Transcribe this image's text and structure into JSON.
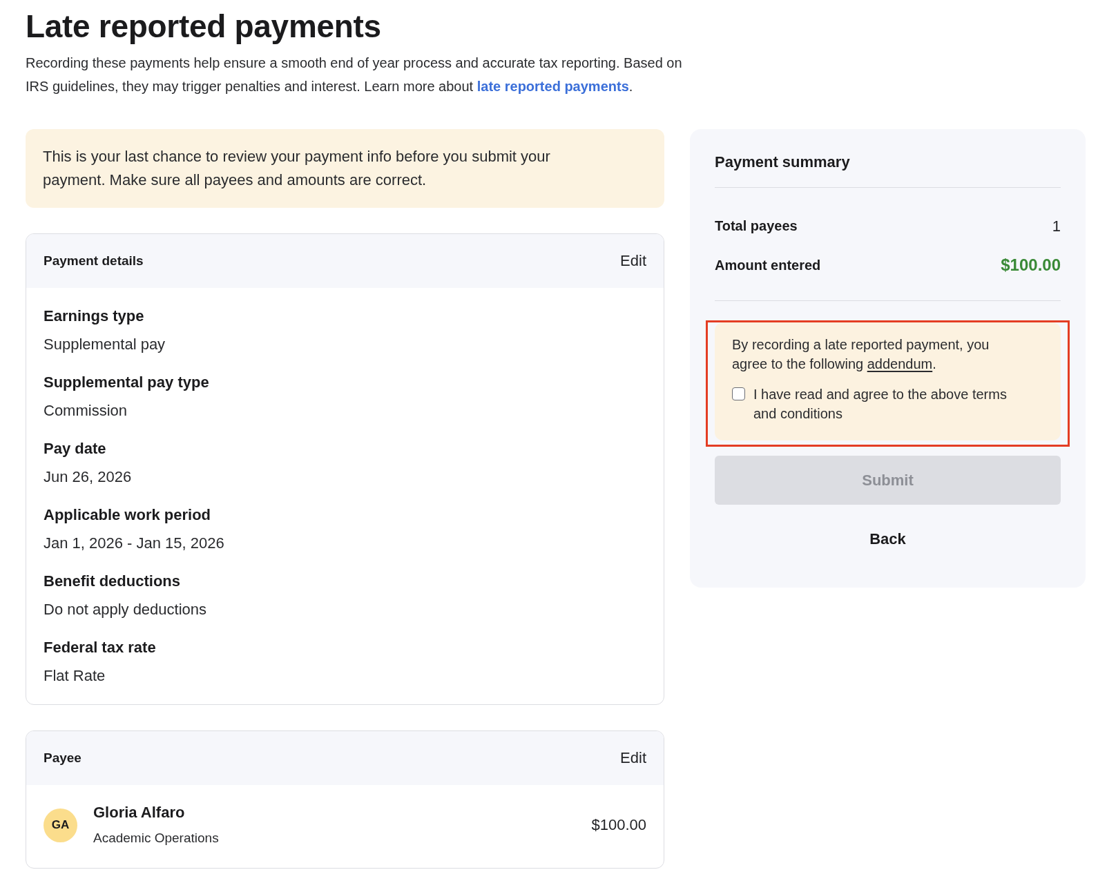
{
  "page_title": "Late reported payments",
  "intro": {
    "text": "Recording these payments help ensure a smooth end of year process and accurate tax reporting. Based on IRS guidelines, they may trigger penalties and interest. Learn more about",
    "link": "late reported payments",
    "end": "."
  },
  "notice": {
    "text": "This is your last chance to review your payment info before you submit your payment. Make sure all payees and amounts are correct."
  },
  "payment_details": {
    "title": "Payment details",
    "edit": "Edit",
    "fields": [
      {
        "label": "Earnings type",
        "value": "Supplemental pay"
      },
      {
        "label": "Supplemental pay type",
        "value": "Commission"
      },
      {
        "label": "Pay date",
        "value": "Jun 26, 2026"
      },
      {
        "label": "Applicable work period",
        "value": "Jan 1, 2026 - Jan 15, 2026"
      },
      {
        "label": "Benefit deductions",
        "value": "Do not apply deductions"
      },
      {
        "label": "Federal tax rate",
        "value": "Flat Rate"
      }
    ]
  },
  "payee": {
    "title": "Payee",
    "edit": "Edit",
    "payees": [
      {
        "initials": "GA",
        "name": "Gloria Alfaro",
        "department": "Academic Operations",
        "amount": "$100.00"
      }
    ]
  },
  "summary": {
    "title": "Payment summary",
    "rows": [
      {
        "kind": "count",
        "label": "Total payees",
        "value": "1"
      },
      {
        "kind": "amount",
        "label": "Amount entered",
        "value": "$100.00"
      }
    ]
  },
  "agreement": {
    "highlighted": true,
    "text": "By recording a late reported payment, you agree to the following",
    "link": "addendum",
    "end": ".",
    "checkbox": {
      "label": "I have read and agree to the above terms and conditions",
      "checked": false
    }
  },
  "submit": {
    "label": "Submit",
    "disabled": true
  },
  "back": {
    "label": "Back"
  }
}
